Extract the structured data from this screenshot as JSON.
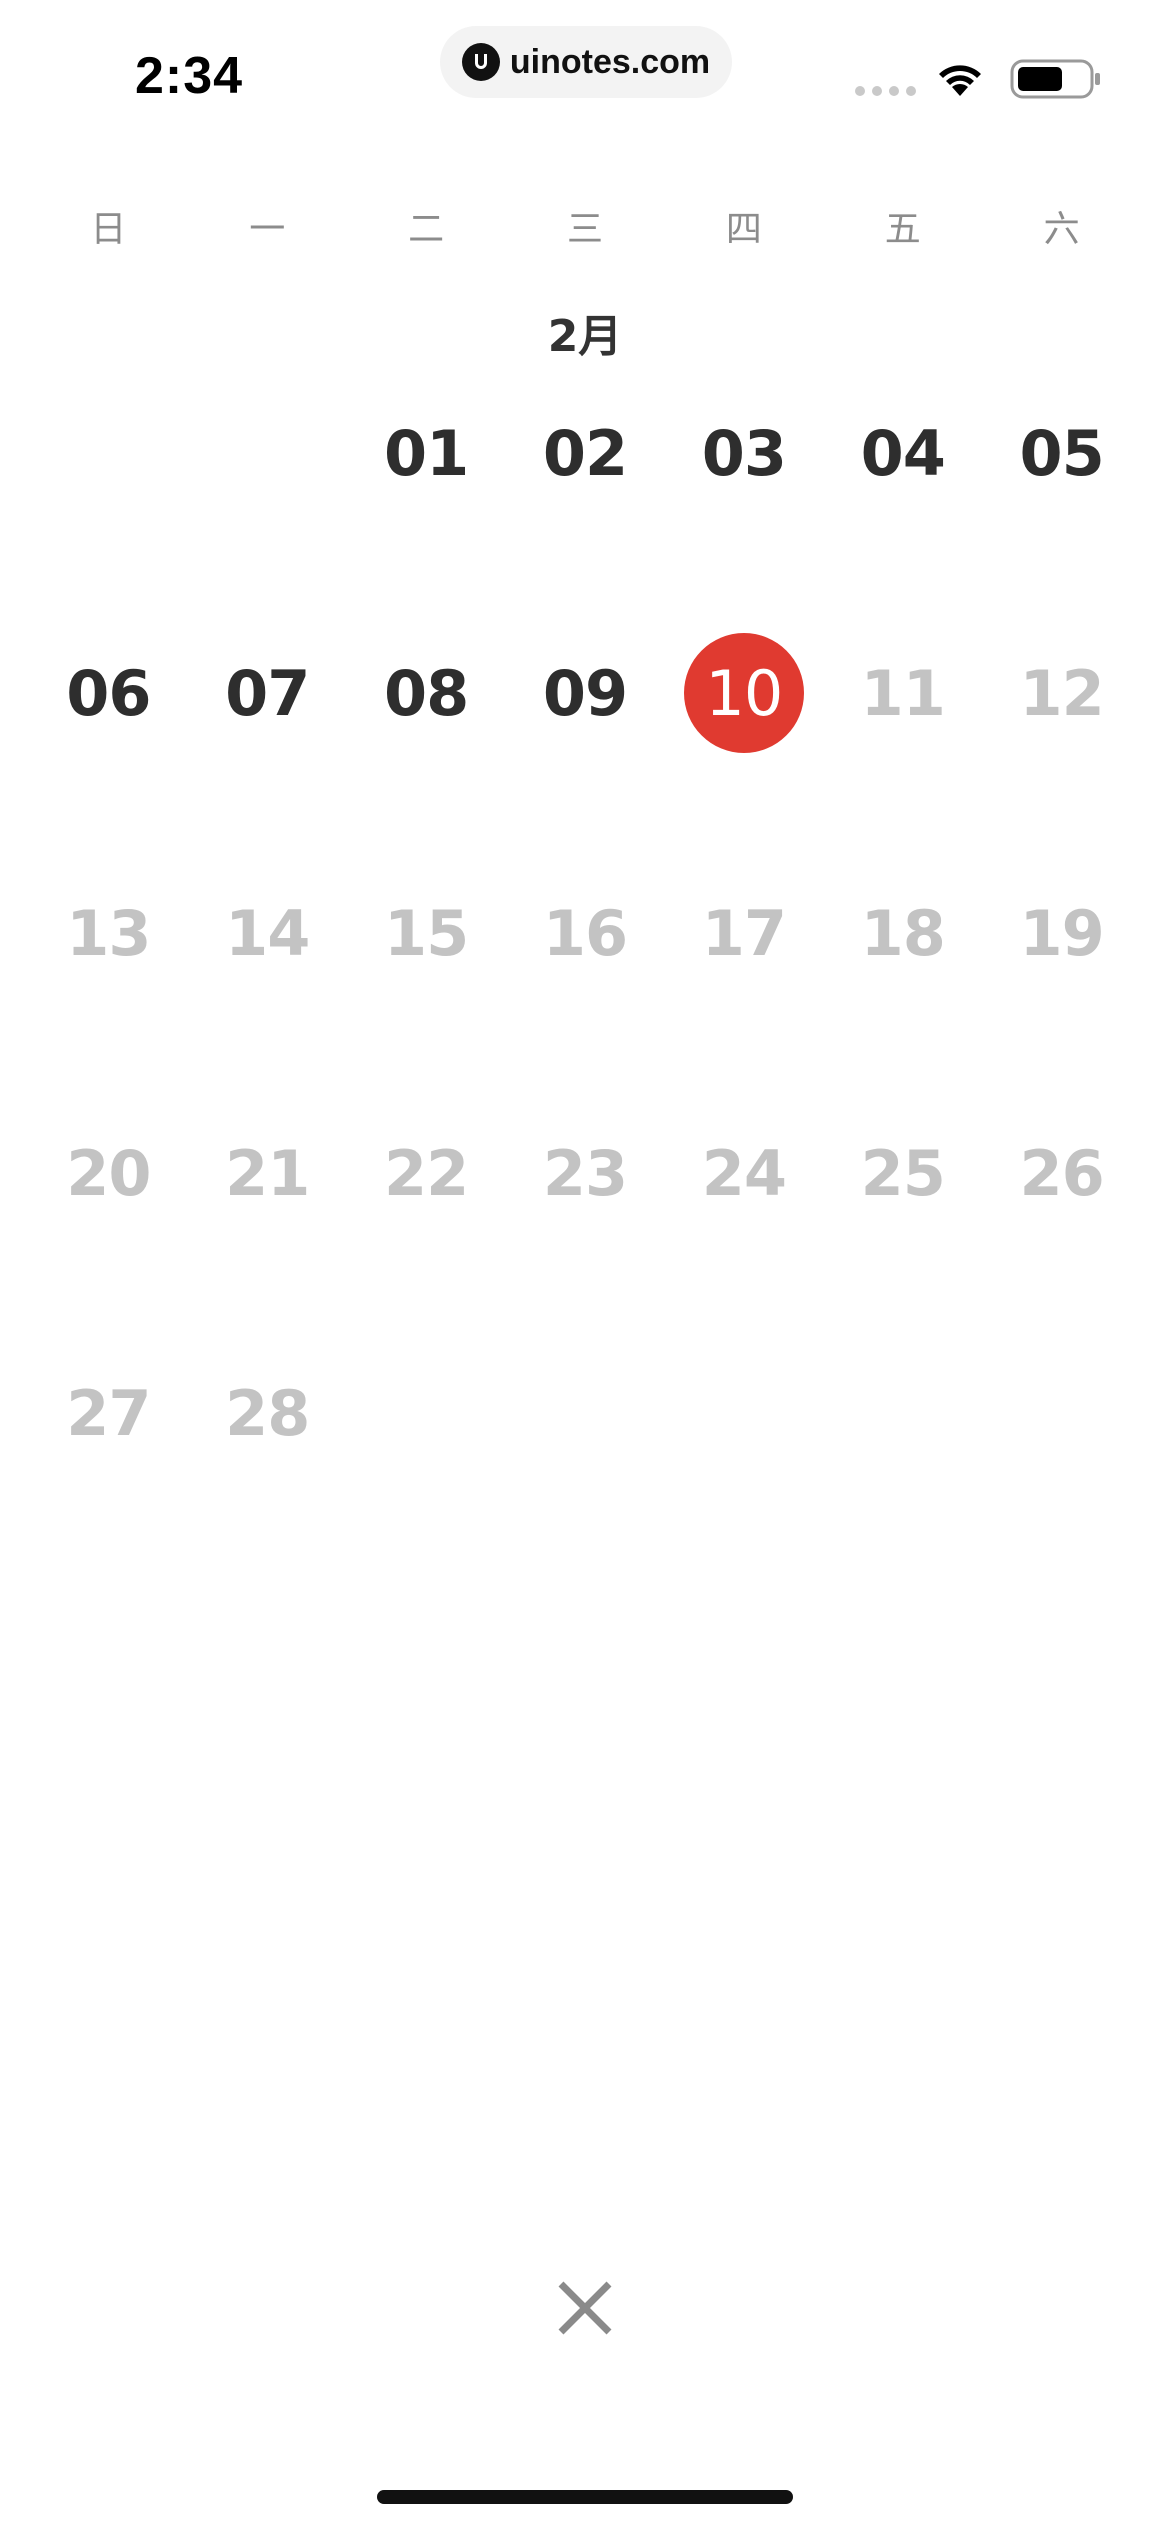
{
  "status_bar": {
    "time": "2:34",
    "url": "uinotes.com"
  },
  "weekdays": [
    "日",
    "一",
    "二",
    "三",
    "四",
    "五",
    "六"
  ],
  "month_label": "2月",
  "colors": {
    "today": "#e03a30",
    "active_text": "#2e2e2e",
    "dim_text": "#c3c3c3"
  },
  "weeks": [
    [
      {
        "label": "",
        "state": "blank"
      },
      {
        "label": "",
        "state": "blank"
      },
      {
        "label": "01",
        "state": "active"
      },
      {
        "label": "02",
        "state": "active"
      },
      {
        "label": "03",
        "state": "active"
      },
      {
        "label": "04",
        "state": "active"
      },
      {
        "label": "05",
        "state": "active"
      }
    ],
    [
      {
        "label": "06",
        "state": "active"
      },
      {
        "label": "07",
        "state": "active"
      },
      {
        "label": "08",
        "state": "active"
      },
      {
        "label": "09",
        "state": "active"
      },
      {
        "label": "10",
        "state": "today"
      },
      {
        "label": "11",
        "state": "dim"
      },
      {
        "label": "12",
        "state": "dim"
      }
    ],
    [
      {
        "label": "13",
        "state": "dim"
      },
      {
        "label": "14",
        "state": "dim"
      },
      {
        "label": "15",
        "state": "dim"
      },
      {
        "label": "16",
        "state": "dim"
      },
      {
        "label": "17",
        "state": "dim"
      },
      {
        "label": "18",
        "state": "dim"
      },
      {
        "label": "19",
        "state": "dim"
      }
    ],
    [
      {
        "label": "20",
        "state": "dim"
      },
      {
        "label": "21",
        "state": "dim"
      },
      {
        "label": "22",
        "state": "dim"
      },
      {
        "label": "23",
        "state": "dim"
      },
      {
        "label": "24",
        "state": "dim"
      },
      {
        "label": "25",
        "state": "dim"
      },
      {
        "label": "26",
        "state": "dim"
      }
    ],
    [
      {
        "label": "27",
        "state": "dim"
      },
      {
        "label": "28",
        "state": "dim"
      }
    ]
  ],
  "close_icon": "close-icon"
}
